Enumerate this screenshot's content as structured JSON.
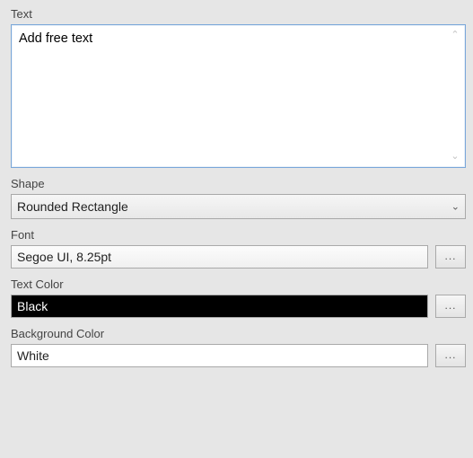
{
  "labels": {
    "text": "Text",
    "shape": "Shape",
    "font": "Font",
    "text_color": "Text Color",
    "background_color": "Background Color"
  },
  "text_value": "Add free text",
  "shape_value": "Rounded Rectangle",
  "font_value": "Segoe UI, 8.25pt",
  "text_color_value": "Black",
  "background_color_value": "White",
  "buttons": {
    "font_picker": "...",
    "text_color_picker": "...",
    "background_color_picker": "..."
  }
}
